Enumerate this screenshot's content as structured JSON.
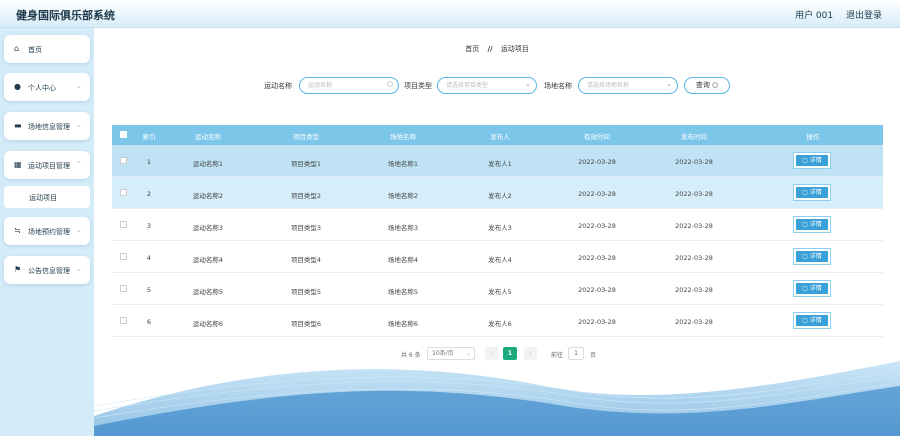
{
  "app": {
    "title": "健身国际俱乐部系统",
    "user": "用户 001",
    "logout": "退出登录"
  },
  "sidebar": {
    "items": [
      {
        "label": "首页",
        "icon": "home-icon"
      },
      {
        "label": "个人中心",
        "icon": "user-icon"
      },
      {
        "label": "场地信息管理",
        "icon": "monitor-icon"
      },
      {
        "label": "运动项目管理",
        "icon": "grid-icon"
      },
      {
        "label": "运动项目",
        "icon": ""
      },
      {
        "label": "场地预约管理",
        "icon": "sliders-icon"
      },
      {
        "label": "公告信息管理",
        "icon": "flag-icon"
      }
    ]
  },
  "breadcrumb": {
    "home": "首页",
    "sep": "//",
    "current": "运动项目"
  },
  "search": {
    "name_label": "运动名称",
    "name_placeholder": "运动名称",
    "type_label": "项目类型",
    "type_placeholder": "请选择项目类型",
    "venue_label": "场地名称",
    "venue_placeholder": "请选择场地名称",
    "button": "查询"
  },
  "table": {
    "headers": [
      "索引",
      "运动名称",
      "项目类型",
      "场地名称",
      "发布人",
      "有效时间",
      "发布时间",
      "操作"
    ],
    "rows": [
      {
        "index": "1",
        "name": "运动名称1",
        "type": "项目类型1",
        "venue": "场地名称1",
        "publisher": "发布人1",
        "valid": "2022-03-28",
        "published": "2022-03-28",
        "action": "详情"
      },
      {
        "index": "2",
        "name": "运动名称2",
        "type": "项目类型2",
        "venue": "场地名称2",
        "publisher": "发布人2",
        "valid": "2022-03-28",
        "published": "2022-03-28",
        "action": "详情"
      },
      {
        "index": "3",
        "name": "运动名称3",
        "type": "项目类型3",
        "venue": "场地名称3",
        "publisher": "发布人3",
        "valid": "2022-03-28",
        "published": "2022-03-28",
        "action": "详情"
      },
      {
        "index": "4",
        "name": "运动名称4",
        "type": "项目类型4",
        "venue": "场地名称4",
        "publisher": "发布人4",
        "valid": "2022-03-28",
        "published": "2022-03-28",
        "action": "详情"
      },
      {
        "index": "5",
        "name": "运动名称5",
        "type": "项目类型5",
        "venue": "场地名称5",
        "publisher": "发布人5",
        "valid": "2022-03-28",
        "published": "2022-03-28",
        "action": "详情"
      },
      {
        "index": "6",
        "name": "运动名称6",
        "type": "项目类型6",
        "venue": "场地名称6",
        "publisher": "发布人6",
        "valid": "2022-03-28",
        "published": "2022-03-28",
        "action": "详情"
      }
    ]
  },
  "pagination": {
    "total": "共 6 条",
    "page_size": "10条/页",
    "current": "1",
    "goto": "前往",
    "goto_value": "1",
    "unit": "页"
  },
  "colors": {
    "accent": "#5ab7e6",
    "header": "#7cc6ea",
    "button": "#3aa0d8",
    "current_page": "#1ba97d"
  }
}
